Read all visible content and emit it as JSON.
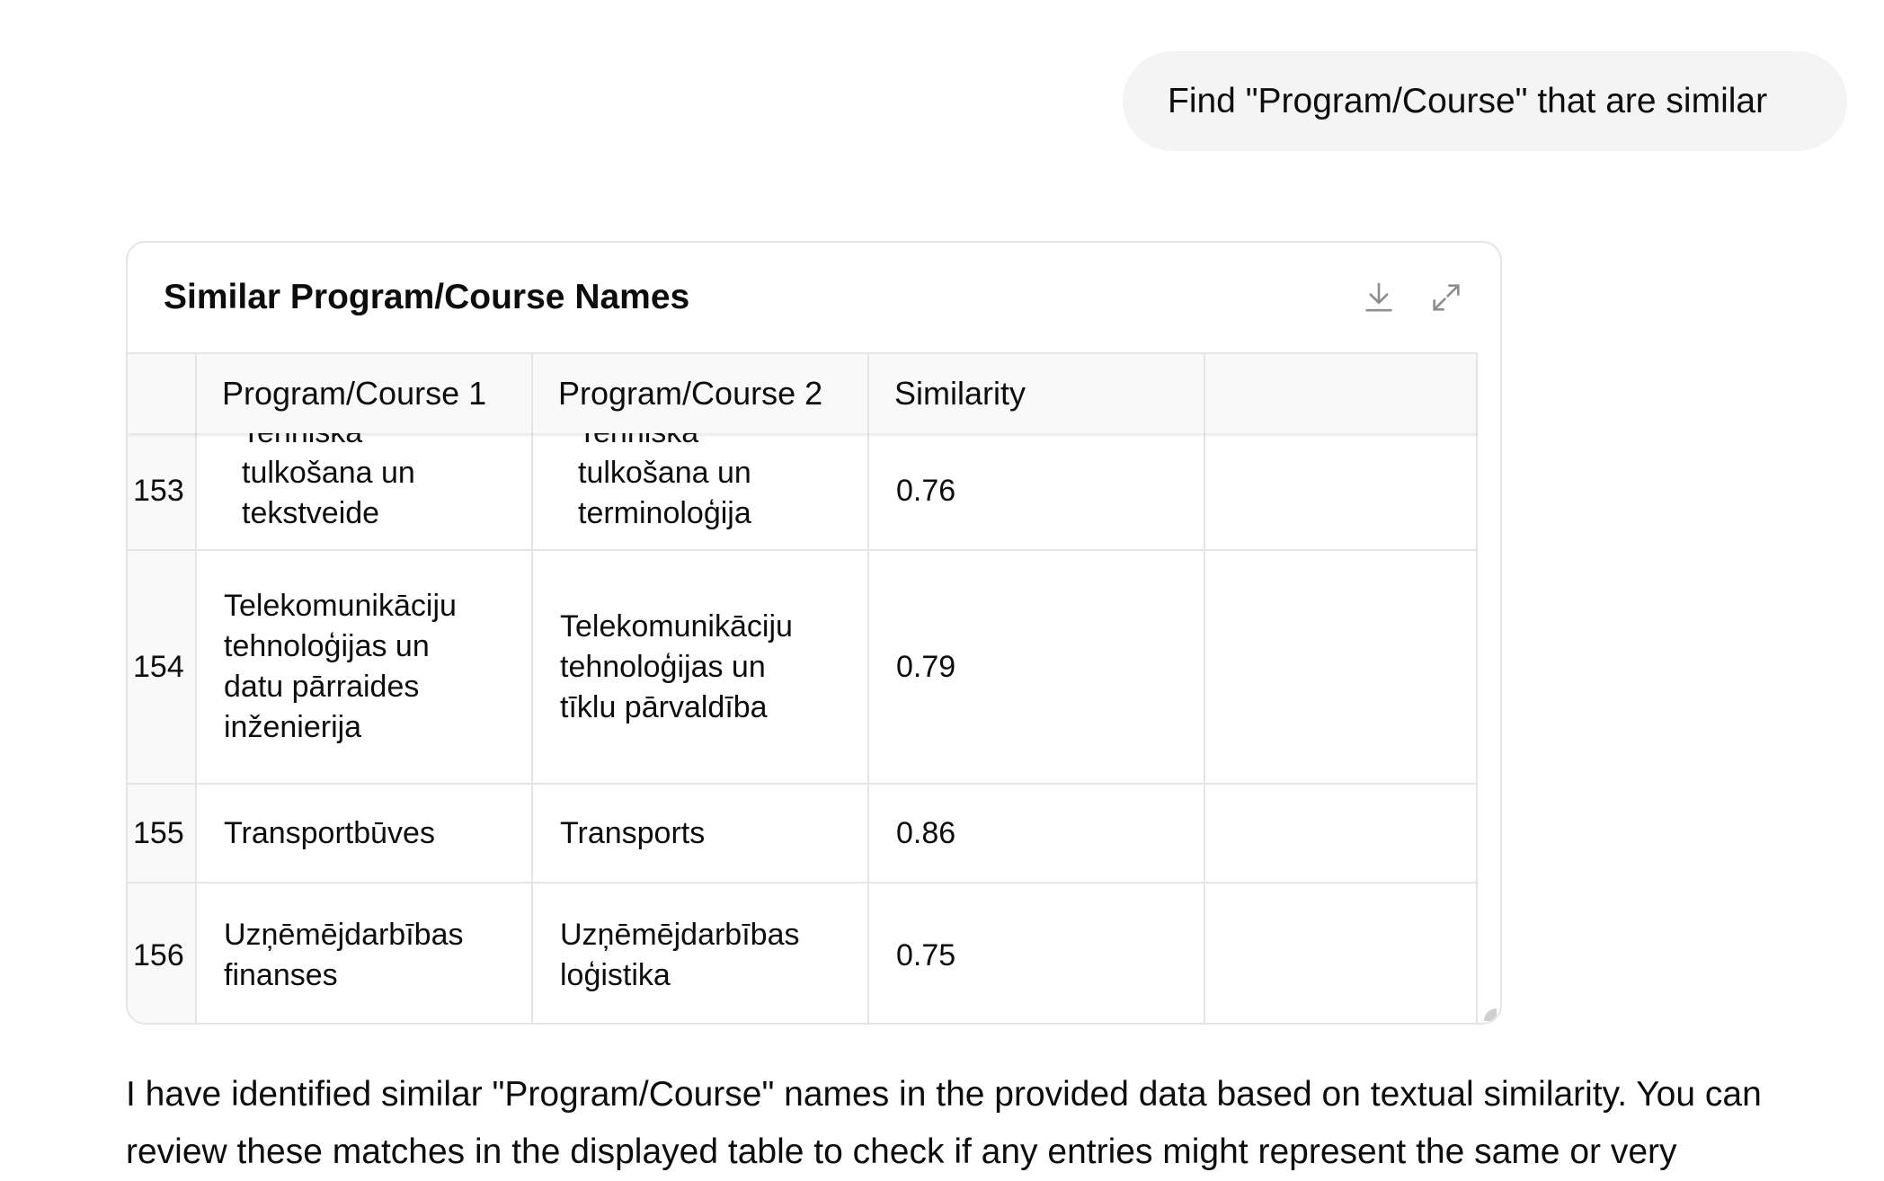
{
  "user_message": "Find \"Program/Course\" that are similar",
  "table_card": {
    "title": "Similar Program/Course Names",
    "download_icon": "download-icon",
    "expand_icon": "expand-icon",
    "columns": [
      "",
      "Program/Course 1",
      "Program/Course 2",
      "Similarity",
      ""
    ],
    "rows": [
      {
        "index": "153",
        "course1": "Tehniskā\ntulkošana un\ntekstveide",
        "course2": "Tehniskā\ntulkošana un\nterminoloģija",
        "similarity": "0.76"
      },
      {
        "index": "154",
        "course1": "  Telekomunikāciju\ntehnoloģijas un\ndatu pārraides\ninženierija",
        "course2": "  Telekomunikāciju\ntehnoloģijas un\ntīklu pārvaldība",
        "similarity": "0.79"
      },
      {
        "index": "155",
        "course1": "  Transportbūves",
        "course2": "  Transports",
        "similarity": "0.86"
      },
      {
        "index": "156",
        "course1": "  Uzņēmējdarbības\nfinanses",
        "course2": "  Uzņēmējdarbības\nloģistika",
        "similarity": "0.75"
      }
    ]
  },
  "assistant_message": "I have identified similar \"Program/Course\" names in the provided data based on textual similarity. You can review these matches in the displayed table to check if any entries might represent the same or very"
}
